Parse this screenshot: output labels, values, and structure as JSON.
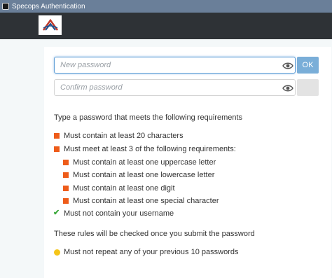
{
  "window": {
    "title": "Specops Authentication"
  },
  "form": {
    "new_password_placeholder": "New password",
    "confirm_password_placeholder": "Confirm password",
    "ok_label": "OK"
  },
  "requirements": {
    "intro": "Type a password that meets the following requirements",
    "r1": "Must contain at least 20 characters",
    "r2": "Must meet at least 3 of the following requirements:",
    "sub1": "Must contain at least one uppercase letter",
    "sub2": "Must contain at least one lowercase letter",
    "sub3": "Must contain at least one digit",
    "sub4": "Must contain at least one special character",
    "r3": "Must not contain your username",
    "note": "These rules will be checked once you submit the password",
    "history": "Must not repeat any of your previous 10 passwords"
  },
  "colors": {
    "unmet": "#ee5c1a",
    "met": "#3aa83a",
    "pending": "#f5c518",
    "accent": "#7aaed8"
  }
}
